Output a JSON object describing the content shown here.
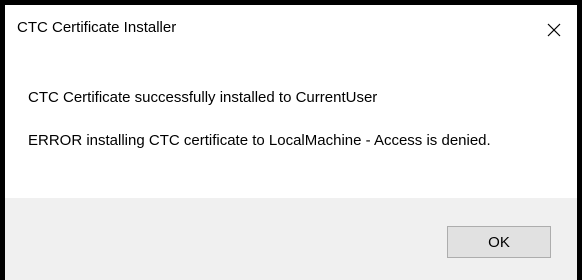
{
  "window": {
    "title": "CTC Certificate Installer",
    "close_icon": "close-icon"
  },
  "messages": {
    "line1": "CTC Certificate successfully installed to CurrentUser",
    "line2": "ERROR installing CTC certificate to LocalMachine - Access is denied."
  },
  "buttons": {
    "ok_label": "OK"
  }
}
